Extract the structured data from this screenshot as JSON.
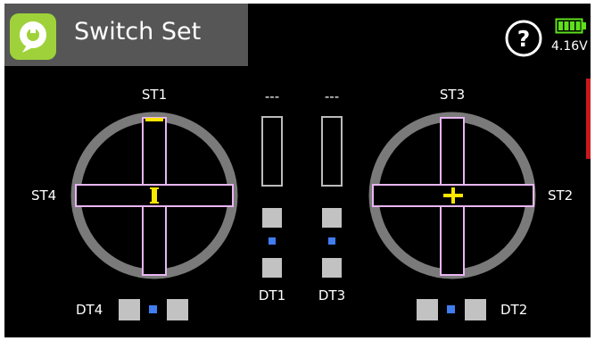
{
  "header": {
    "title": "Switch Set",
    "app_icon": "q-bubble-icon"
  },
  "status": {
    "help_icon": "help-circle-icon",
    "battery_icon": "battery-icon",
    "battery_voltage": "4.16V",
    "battery_color": "#5ee01b"
  },
  "left_stick": {
    "vertical_label": "ST1",
    "horizontal_label": "ST4",
    "trim_label": "DT4",
    "cursor_icon": "vertical-bar-cursor-icon"
  },
  "right_stick": {
    "vertical_label": "ST3",
    "horizontal_label": "ST2",
    "trim_label": "DT2",
    "cursor_icon": "crosshair-cursor-icon"
  },
  "middle": {
    "channel_1": {
      "value": "---",
      "trim_label": "DT1"
    },
    "channel_2": {
      "value": "---",
      "trim_label": "DT3"
    }
  },
  "colors": {
    "background": "#000000",
    "header": "#565656",
    "app_icon": "#9fd23a",
    "ring": "#7a7a7a",
    "cross_outline": "#e8b5f2",
    "cursor": "#ffe600",
    "trim_button": "#c2c2c2",
    "trim_dot": "#3f7df0",
    "accent_strip": "#c8191c"
  }
}
